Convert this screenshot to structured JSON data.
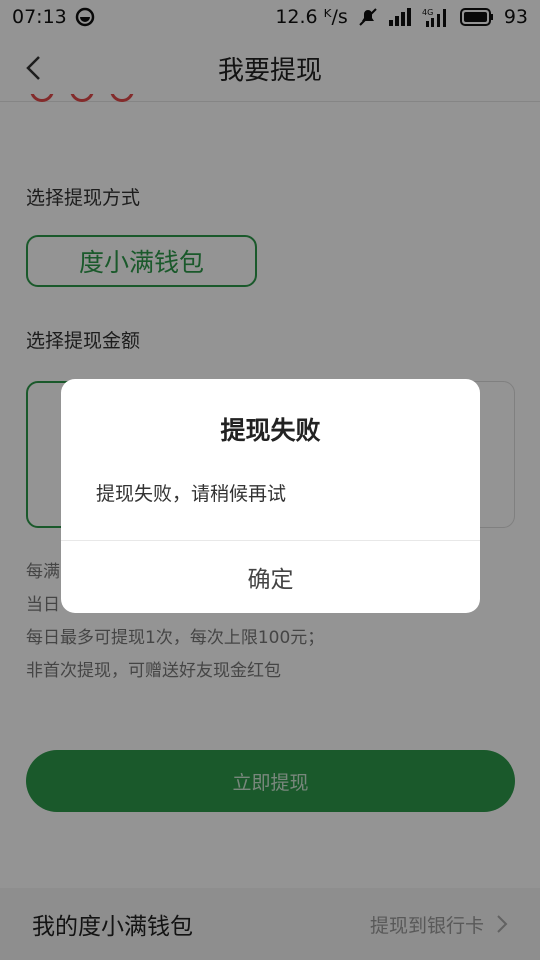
{
  "status_bar": {
    "time": "07:13",
    "speed": "12.6 ᴷ/s",
    "network": "4G",
    "battery": "93"
  },
  "header": {
    "title": "我要提现"
  },
  "method_section": {
    "label": "选择提现方式",
    "option": "度小满钱包"
  },
  "amount_section": {
    "label": "选择提现金额"
  },
  "notes": [
    "每满",
    "当日",
    "每日最多可提现1次，每次上限100元；",
    "非首次提现，可赠送好友现金红包"
  ],
  "withdraw_button": "立即提现",
  "bottom_bar": {
    "wallet_label": "我的度小满钱包",
    "to_bank": "提现到银行卡"
  },
  "dialog": {
    "title": "提现失败",
    "message": "提现失败，请稍候再试",
    "confirm": "确定"
  },
  "colors": {
    "accent": "#2e9a4a",
    "overlay": "rgba(0,0,0,0.42)"
  }
}
